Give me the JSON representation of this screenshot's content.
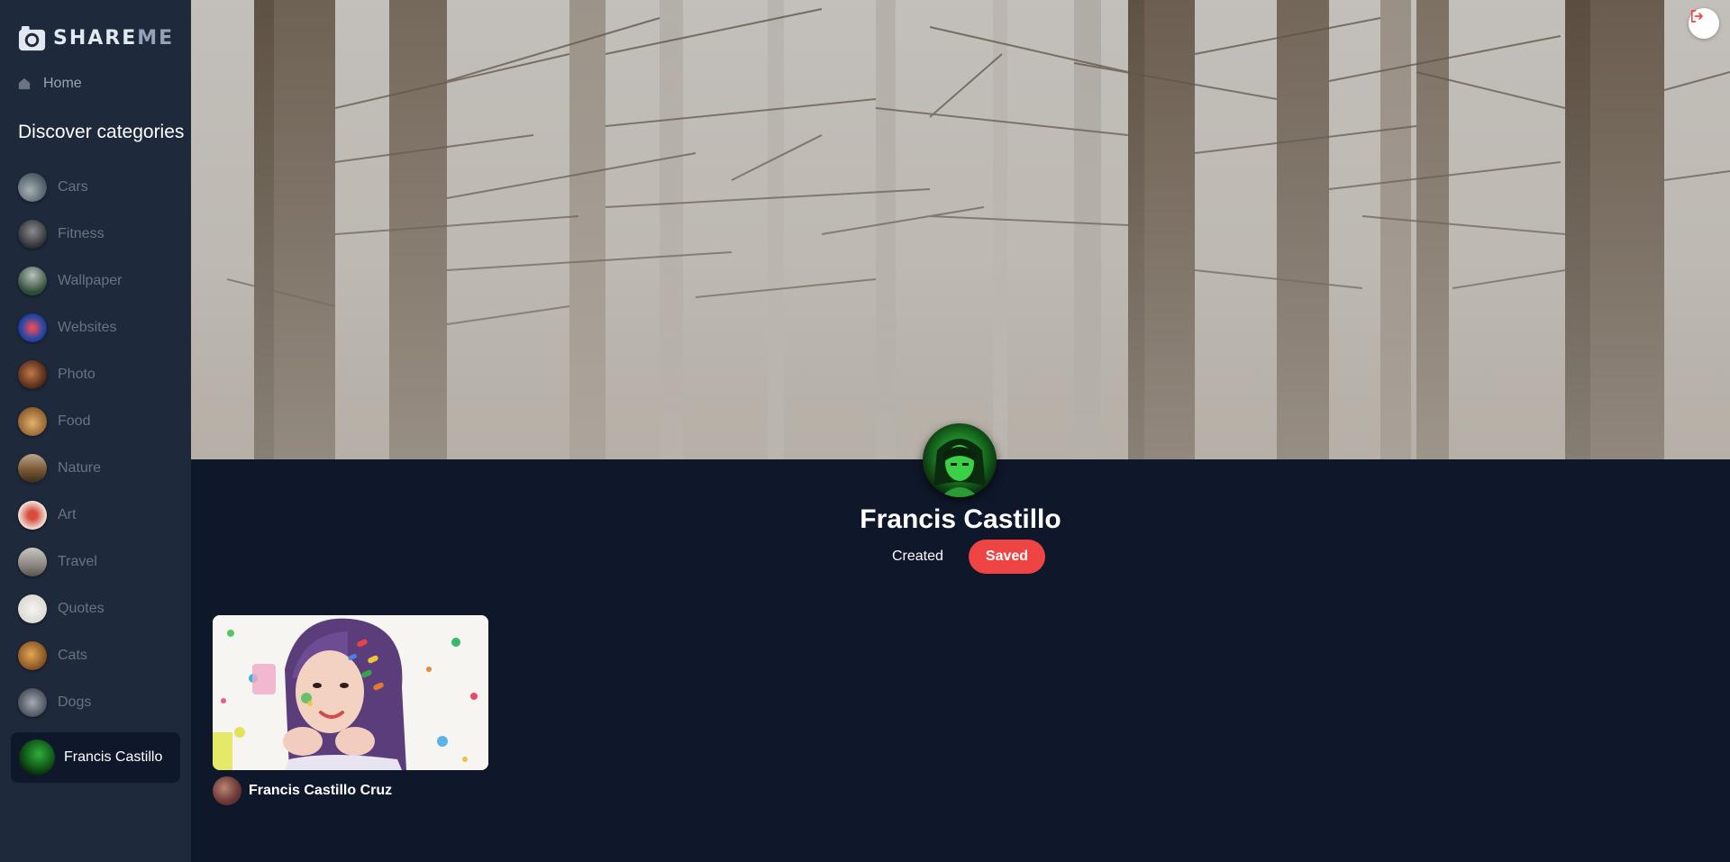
{
  "app": {
    "brand_primary": "SHARE",
    "brand_secondary": "ME",
    "brand_icon": "camera-icon"
  },
  "sidebar": {
    "home_label": "Home",
    "home_icon": "home-icon",
    "categories_heading": "Discover categories",
    "categories": [
      {
        "label": "Cars",
        "thumb_color": "#6b7a86"
      },
      {
        "label": "Fitness",
        "thumb_color": "#4b4f55"
      },
      {
        "label": "Wallpaper",
        "thumb_color": "#3f5a45"
      },
      {
        "label": "Websites",
        "thumb_color": "#2f4fa8"
      },
      {
        "label": "Photo",
        "thumb_color": "#6a3c25"
      },
      {
        "label": "Food",
        "thumb_color": "#b78646"
      },
      {
        "label": "Nature",
        "thumb_color": "#8b6a42"
      },
      {
        "label": "Art",
        "thumb_color": "#d1574a"
      },
      {
        "label": "Travel",
        "thumb_color": "#8f8a86"
      },
      {
        "label": "Quotes",
        "thumb_color": "#ecebe6"
      },
      {
        "label": "Cats",
        "thumb_color": "#c9893b"
      },
      {
        "label": "Dogs",
        "thumb_color": "#66707c"
      }
    ],
    "profile_name": "Francis Castillo"
  },
  "profile": {
    "name": "Francis Castillo",
    "tabs": {
      "created": "Created",
      "saved": "Saved"
    },
    "active_tab": "saved",
    "logout_icon": "logout-icon"
  },
  "pins": [
    {
      "author": "Francis Castillo Cruz"
    }
  ],
  "colors": {
    "background": "#0f172a",
    "sidebar": "#1e293b",
    "accent": "#ef4444"
  }
}
